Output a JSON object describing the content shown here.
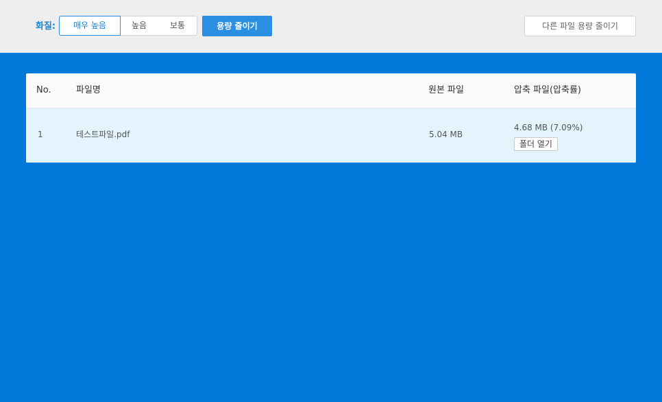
{
  "toolbar": {
    "quality_label": "화질:",
    "quality_options": [
      {
        "label": "매우 높음",
        "selected": true
      },
      {
        "label": "높음",
        "selected": false
      },
      {
        "label": "보통",
        "selected": false
      }
    ],
    "compress_button": "용량 줄이기",
    "other_file_button": "다른 파일 용량 줄이기"
  },
  "table": {
    "headers": {
      "no": "No.",
      "filename": "파일명",
      "original": "원본 파일",
      "compressed": "압축 파일(압축률)"
    },
    "rows": [
      {
        "no": "1",
        "filename": "테스트파일.pdf",
        "original_size": "5.04 MB",
        "compressed_size": "4.68 MB (7.09%)",
        "open_folder": "폴더 열기"
      }
    ]
  },
  "colors": {
    "background": "#0079db",
    "accent": "#2a8fe0",
    "toolbar_bg": "#eeeeee",
    "row_highlight": "#e3f4fd"
  }
}
